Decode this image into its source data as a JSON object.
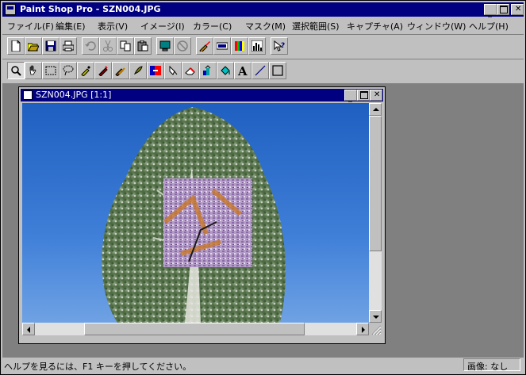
{
  "window": {
    "title": "Paint Shop Pro - SZN004.JPG"
  },
  "menu": [
    {
      "label": "ファイル(F)"
    },
    {
      "label": "編集(E)"
    },
    {
      "label": "表示(V)"
    },
    {
      "label": "イメージ(I)"
    },
    {
      "label": "カラー(C)"
    },
    {
      "label": "マスク(M)"
    },
    {
      "label": "選択範囲(S)"
    },
    {
      "label": "キャプチャ(A)"
    },
    {
      "label": "ウィンドウ(W)"
    },
    {
      "label": "ヘルプ(H)"
    }
  ],
  "toolbar_main": [
    "new-icon",
    "open-icon",
    "save-icon",
    "print-icon",
    "undo-icon",
    "cut-icon",
    "copy-icon",
    "paste-icon",
    "monitor-icon",
    "disabled-icon",
    "brush-color-icon",
    "histogram-bar-icon",
    "color-palette-icon",
    "histogram-icon",
    "help-context-icon"
  ],
  "toolbar_tools": [
    "zoom-icon",
    "pan-hand-icon",
    "selection-rect-icon",
    "lasso-icon",
    "eyedropper-icon",
    "paintbrush-icon",
    "clone-brush-icon",
    "retouch-icon",
    "color-replacer-icon",
    "push-brush-icon",
    "eraser-icon",
    "picture-tube-icon",
    "flood-fill-icon",
    "text-icon",
    "line-icon",
    "shape-icon"
  ],
  "document": {
    "title": "SZN004.JPG [1:1]"
  },
  "status": {
    "help_text": "ヘルプを見るには、F1 キーを押してください。",
    "image_info": "画像: なし"
  }
}
